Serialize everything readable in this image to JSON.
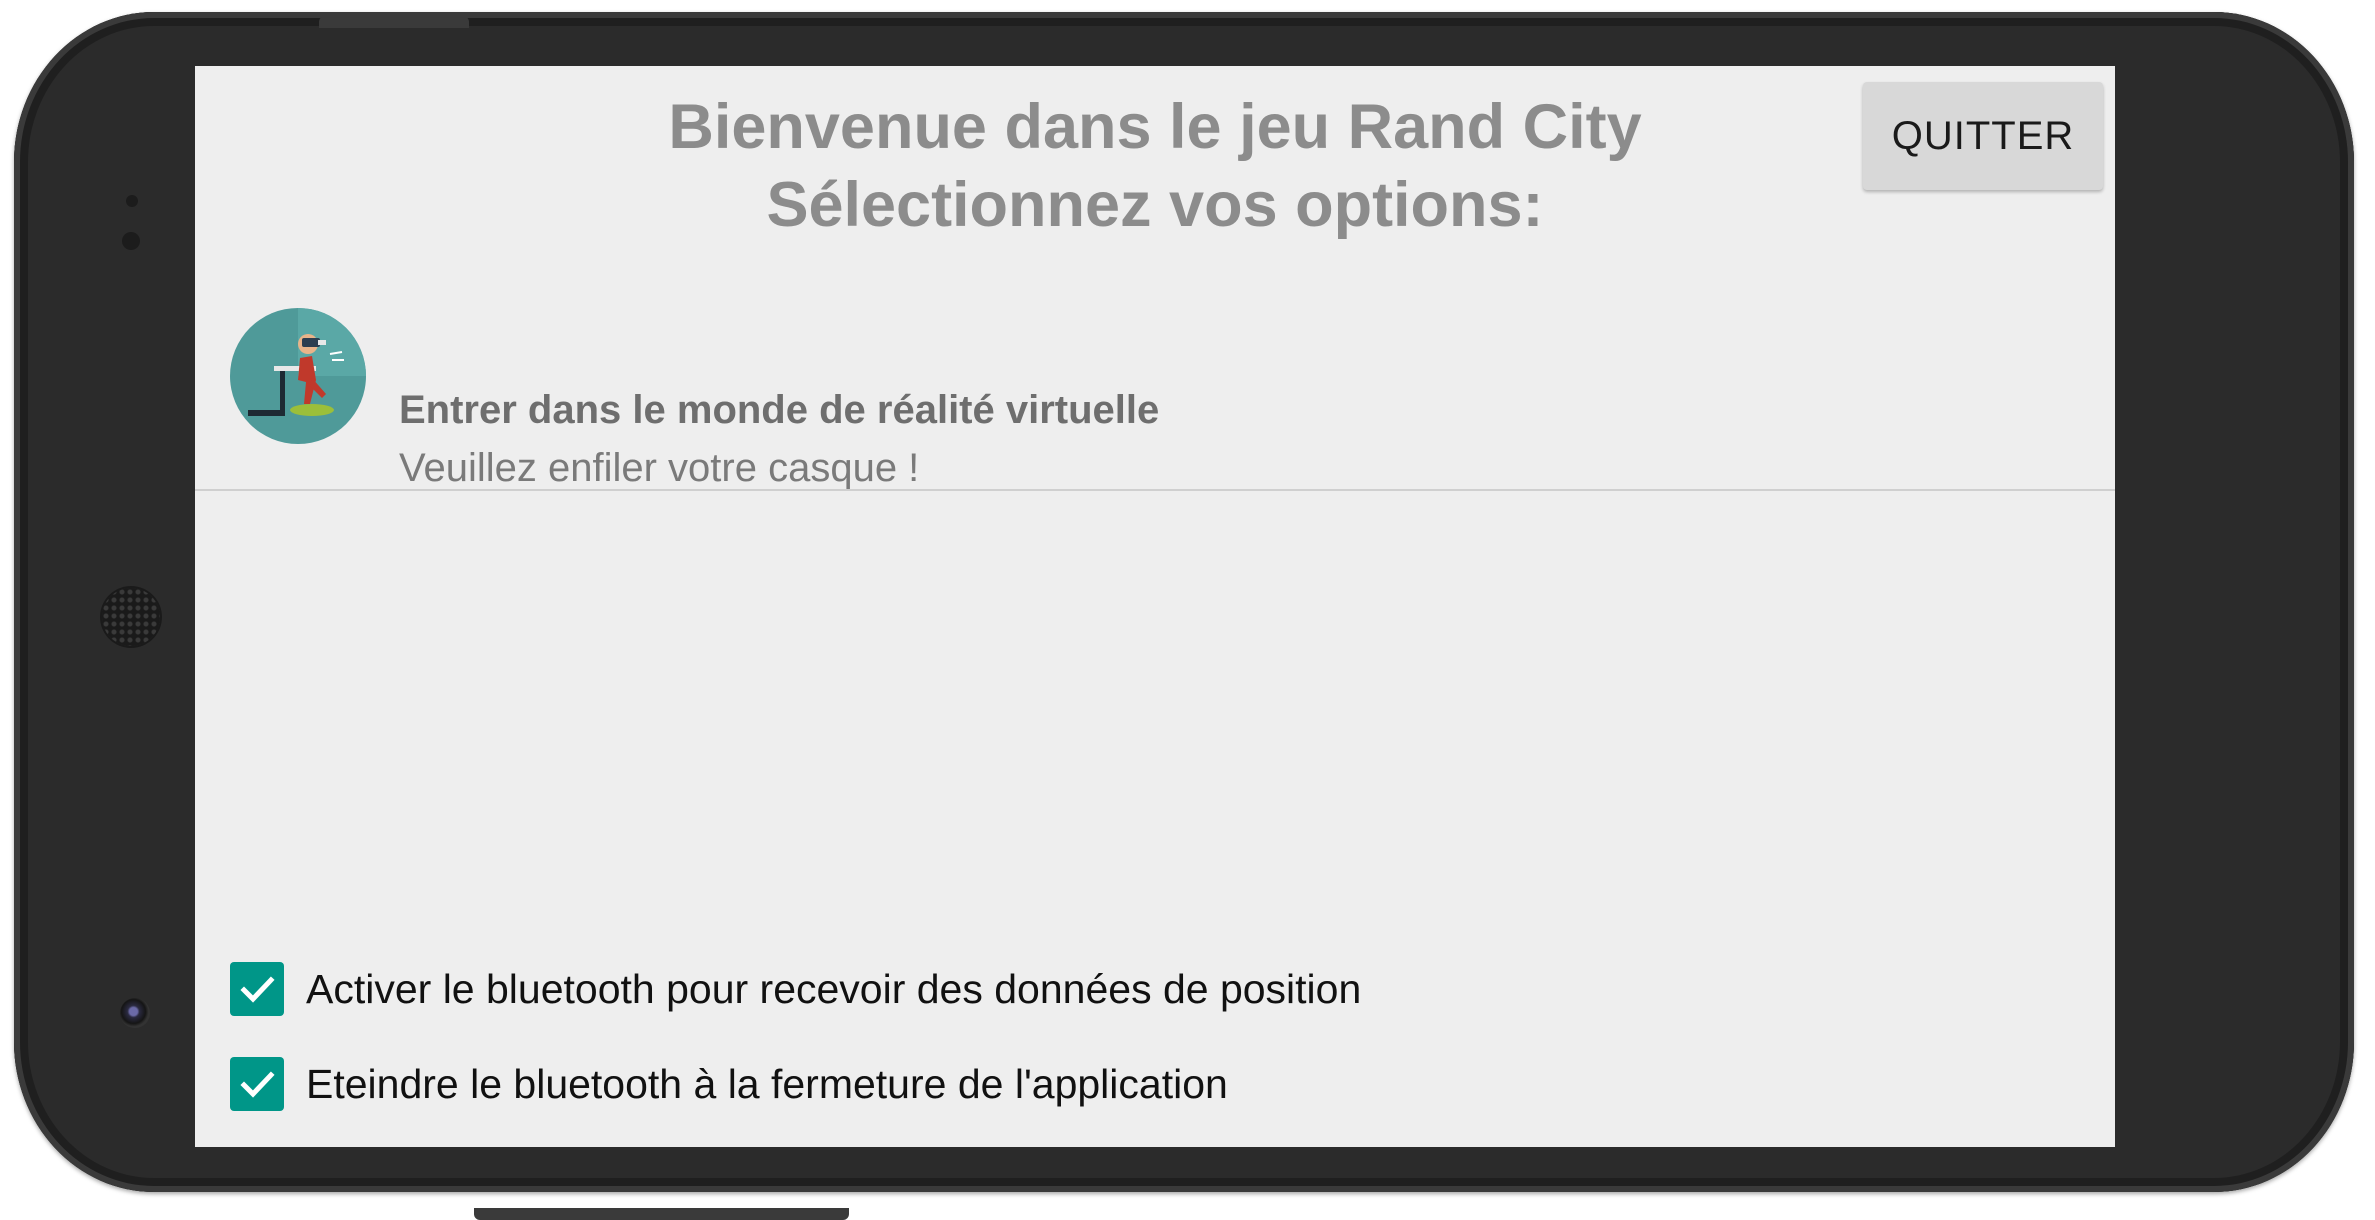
{
  "header": {
    "title_line1": "Bienvenue dans le jeu Rand City",
    "title_line2": "Sélectionnez vos options:",
    "quit_label": "QUITTER"
  },
  "vr_option": {
    "title": "Entrer dans le monde de réalité virtuelle",
    "subtitle": "Veuillez enfiler votre casque !",
    "icon": "vr-player-icon"
  },
  "options": [
    {
      "label": "Activer le bluetooth pour recevoir des données de position",
      "checked": true
    },
    {
      "label": "Eteindre le bluetooth à la fermeture de l'application",
      "checked": true
    }
  ],
  "colors": {
    "accent": "#009688",
    "screen_bg": "#eeeeee",
    "title_text": "#8c8c8c",
    "device_frame": "#2b2b2b"
  }
}
